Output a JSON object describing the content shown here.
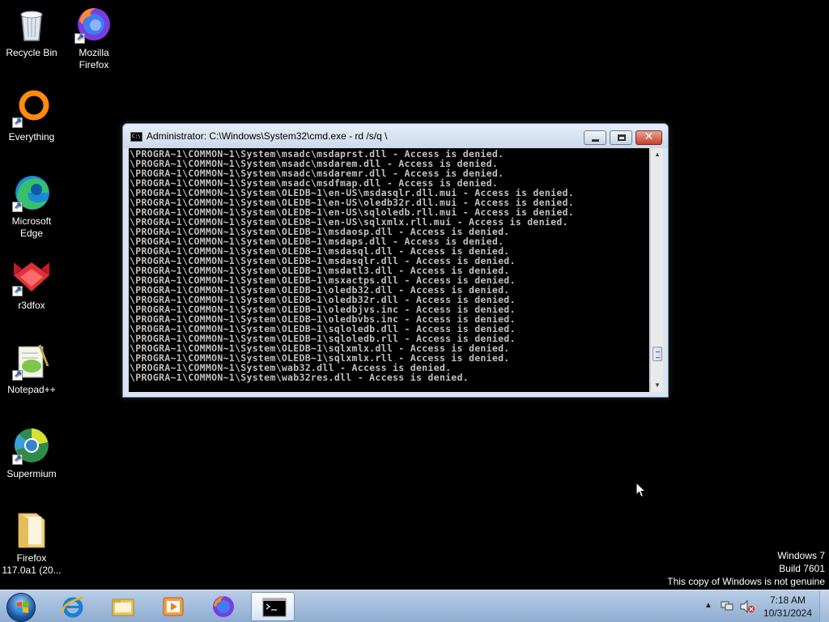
{
  "desktop": {
    "icons": [
      {
        "label": "Recycle Bin",
        "icon": "recycle-bin-icon"
      },
      {
        "label": "Mozilla Firefox",
        "icon": "firefox-icon"
      },
      {
        "label": "Everything",
        "icon": "everything-search-icon"
      },
      {
        "label": "Microsoft Edge",
        "icon": "edge-icon"
      },
      {
        "label": "r3dfox",
        "icon": "r3dfox-icon"
      },
      {
        "label": "Notepad++",
        "icon": "notepad-plus-plus-icon"
      },
      {
        "label": "Supermium",
        "icon": "supermium-icon"
      },
      {
        "label": "Firefox 117.0a1 (20...",
        "icon": "folder-icon"
      }
    ]
  },
  "cmd": {
    "title": "Administrator: C:\\Windows\\System32\\cmd.exe - rd /s/q  \\",
    "lines": [
      "\\PROGRA~1\\COMMON~1\\System\\msadc\\msdaprst.dll - Access is denied.",
      "\\PROGRA~1\\COMMON~1\\System\\msadc\\msdarem.dll - Access is denied.",
      "\\PROGRA~1\\COMMON~1\\System\\msadc\\msdaremr.dll - Access is denied.",
      "\\PROGRA~1\\COMMON~1\\System\\msadc\\msdfmap.dll - Access is denied.",
      "\\PROGRA~1\\COMMON~1\\System\\OLEDB~1\\en-US\\msdasqlr.dll.mui - Access is denied.",
      "\\PROGRA~1\\COMMON~1\\System\\OLEDB~1\\en-US\\oledb32r.dll.mui - Access is denied.",
      "\\PROGRA~1\\COMMON~1\\System\\OLEDB~1\\en-US\\sqloledb.rll.mui - Access is denied.",
      "\\PROGRA~1\\COMMON~1\\System\\OLEDB~1\\en-US\\sqlxmlx.rll.mui - Access is denied.",
      "\\PROGRA~1\\COMMON~1\\System\\OLEDB~1\\msdaosp.dll - Access is denied.",
      "\\PROGRA~1\\COMMON~1\\System\\OLEDB~1\\msdaps.dll - Access is denied.",
      "\\PROGRA~1\\COMMON~1\\System\\OLEDB~1\\msdasql.dll - Access is denied.",
      "\\PROGRA~1\\COMMON~1\\System\\OLEDB~1\\msdasqlr.dll - Access is denied.",
      "\\PROGRA~1\\COMMON~1\\System\\OLEDB~1\\msdatl3.dll - Access is denied.",
      "\\PROGRA~1\\COMMON~1\\System\\OLEDB~1\\msxactps.dll - Access is denied.",
      "\\PROGRA~1\\COMMON~1\\System\\OLEDB~1\\oledb32.dll - Access is denied.",
      "\\PROGRA~1\\COMMON~1\\System\\OLEDB~1\\oledb32r.dll - Access is denied.",
      "\\PROGRA~1\\COMMON~1\\System\\OLEDB~1\\oledbjvs.inc - Access is denied.",
      "\\PROGRA~1\\COMMON~1\\System\\OLEDB~1\\oledbvbs.inc - Access is denied.",
      "\\PROGRA~1\\COMMON~1\\System\\OLEDB~1\\sqloledb.dll - Access is denied.",
      "\\PROGRA~1\\COMMON~1\\System\\OLEDB~1\\sqloledb.rll - Access is denied.",
      "\\PROGRA~1\\COMMON~1\\System\\OLEDB~1\\sqlxmlx.dll - Access is denied.",
      "\\PROGRA~1\\COMMON~1\\System\\OLEDB~1\\sqlxmlx.rll - Access is denied.",
      "\\PROGRA~1\\COMMON~1\\System\\wab32.dll - Access is denied.",
      "\\PROGRA~1\\COMMON~1\\System\\wab32res.dll - Access is denied."
    ],
    "close_glyph": "✕"
  },
  "watermark": {
    "line1": "Windows 7",
    "line2": "Build 7601",
    "line3": "This copy of Windows is not genuine"
  },
  "taskbar": {
    "items": [
      {
        "icon": "internet-explorer-icon"
      },
      {
        "icon": "windows-explorer-icon"
      },
      {
        "icon": "media-player-icon"
      },
      {
        "icon": "firefox-icon"
      },
      {
        "icon": "command-prompt-icon",
        "active": true
      }
    ],
    "tray": {
      "clock_time": "7:18 AM",
      "clock_date": "10/31/2024",
      "show_hidden_glyph": "▲"
    }
  },
  "colors": {
    "desktop_bg": "#000000",
    "console_text": "#c0c0c0",
    "taskbar": "#a9c1df"
  }
}
